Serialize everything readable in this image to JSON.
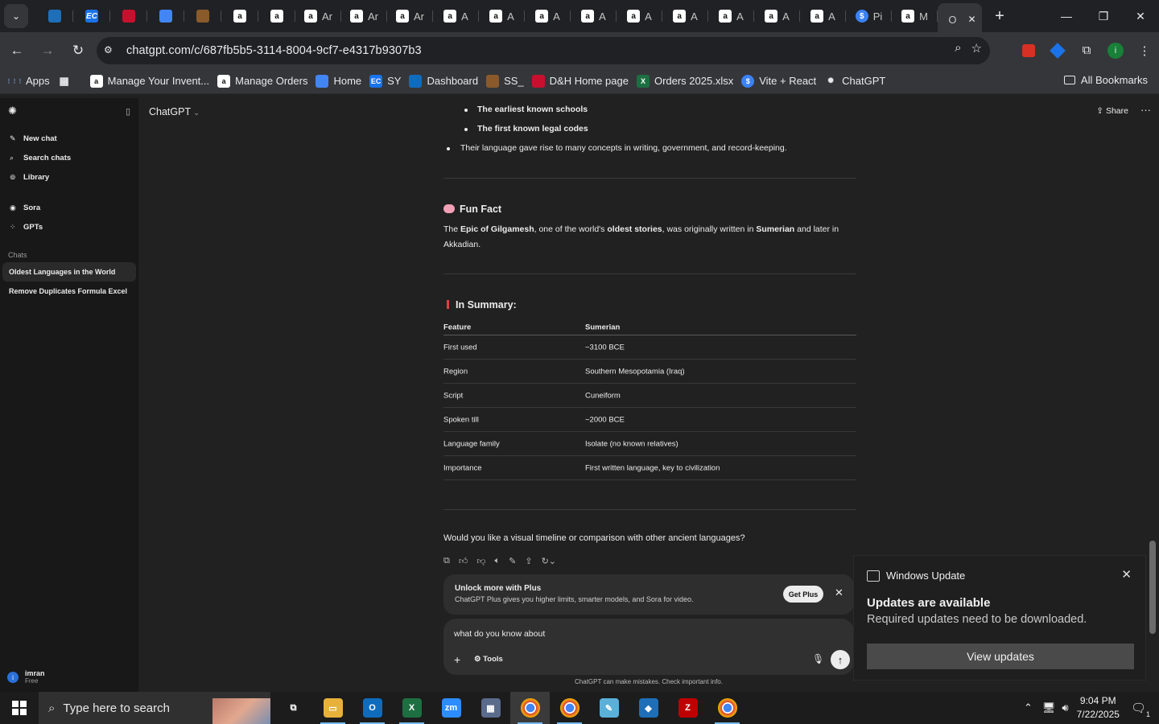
{
  "browser": {
    "tabs": [
      {
        "icon": "app-icon",
        "label": "",
        "bg": "#1e6fb8"
      },
      {
        "icon": "ec-icon",
        "label": "",
        "bg": "#1a73e8"
      },
      {
        "icon": "dh-icon",
        "label": "",
        "bg": "#c8102e"
      },
      {
        "icon": "docs-icon",
        "label": "",
        "bg": "#4285f4"
      },
      {
        "icon": "box-icon",
        "label": "",
        "bg": "#8a5a2b"
      },
      {
        "icon": "amazon-icon",
        "label": "",
        "bg": "#ffffff"
      },
      {
        "icon": "amazon-icon",
        "label": "",
        "bg": "#ffffff"
      },
      {
        "icon": "amazon-icon",
        "label": "Ar",
        "bg": "#ffffff"
      },
      {
        "icon": "amazon-icon",
        "label": "Ar",
        "bg": "#ffffff"
      },
      {
        "icon": "amazon-icon",
        "label": "Ar",
        "bg": "#ffffff"
      },
      {
        "icon": "amazon-icon",
        "label": "A",
        "bg": "#ffffff"
      },
      {
        "icon": "amazon-icon",
        "label": "A",
        "bg": "#ffffff"
      },
      {
        "icon": "amazon-icon",
        "label": "A",
        "bg": "#ffffff"
      },
      {
        "icon": "amazon-icon",
        "label": "A",
        "bg": "#ffffff"
      },
      {
        "icon": "amazon-icon",
        "label": "A",
        "bg": "#ffffff"
      },
      {
        "icon": "amazon-icon",
        "label": "A",
        "bg": "#ffffff"
      },
      {
        "icon": "amazon-icon",
        "label": "A",
        "bg": "#ffffff"
      },
      {
        "icon": "amazon-icon",
        "label": "A",
        "bg": "#ffffff"
      },
      {
        "icon": "amazon-icon",
        "label": "A",
        "bg": "#ffffff"
      },
      {
        "icon": "s-icon",
        "label": "Pi",
        "bg": "#3b82f6"
      },
      {
        "icon": "amazon-icon",
        "label": "M",
        "bg": "#ffffff"
      },
      {
        "icon": "openai-icon",
        "label": "O",
        "bg": "#35363a",
        "active": true
      }
    ],
    "url": "chatgpt.com/c/687fb5b5-3114-8004-9cf7-e4317b9307b3",
    "bookmarks": [
      {
        "icon": "apps-grid-icon",
        "label": "Apps",
        "bg": "#35363a"
      },
      {
        "icon": "grid-icon",
        "label": "",
        "bg": "#35363a"
      },
      {
        "icon": "amazon-icon",
        "label": "Manage Your Invent...",
        "bg": "#ffffff"
      },
      {
        "icon": "amazon-icon",
        "label": "Manage Orders",
        "bg": "#ffffff"
      },
      {
        "icon": "docs-icon",
        "label": "Home",
        "bg": "#4285f4"
      },
      {
        "icon": "ec-icon",
        "label": "SY",
        "bg": "#1a73e8"
      },
      {
        "icon": "dashboard-icon",
        "label": "Dashboard",
        "bg": "#0f6cbd"
      },
      {
        "icon": "box-icon",
        "label": "SS_",
        "bg": "#8a5a2b"
      },
      {
        "icon": "dh-icon",
        "label": "D&H Home page",
        "bg": "#c8102e"
      },
      {
        "icon": "excel-icon",
        "label": "Orders 2025.xlsx",
        "bg": "#1d6f42"
      },
      {
        "icon": "s-icon",
        "label": "Vite + React",
        "bg": "#3b82f6"
      },
      {
        "icon": "openai-icon",
        "label": "ChatGPT",
        "bg": "#35363a"
      }
    ],
    "all_bookmarks": "All Bookmarks"
  },
  "sidebar": {
    "items": [
      {
        "icon": "edit-icon",
        "label": "New chat"
      },
      {
        "icon": "search-icon",
        "label": "Search chats"
      },
      {
        "icon": "library-icon",
        "label": "Library"
      }
    ],
    "items2": [
      {
        "icon": "sora-icon",
        "label": "Sora"
      },
      {
        "icon": "gpts-icon",
        "label": "GPTs"
      }
    ],
    "chats_label": "Chats",
    "chats": [
      {
        "label": "Oldest Languages in the World",
        "selected": true
      },
      {
        "label": "Remove Duplicates Formula Excel",
        "selected": false
      }
    ],
    "user": {
      "initial": "i",
      "name": "imran",
      "plan": "Free"
    }
  },
  "header": {
    "title": "ChatGPT",
    "share": "Share"
  },
  "message": {
    "sub_bullets": [
      "The earliest known schools",
      "The first known legal codes"
    ],
    "bullet": "Their language gave rise to many concepts in writing, government, and record-keeping.",
    "fun_fact_title": "Fun Fact",
    "fun_fact_line1_parts": [
      "The ",
      "Epic of Gilgamesh",
      ", one of the world's ",
      "oldest stories",
      ", was originally written in ",
      "Sumerian",
      " and later in"
    ],
    "fun_fact_line2": "Akkadian.",
    "summary_title": "In Summary:",
    "table": {
      "headers": [
        "Feature",
        "Sumerian"
      ],
      "rows": [
        [
          "First used",
          "~3100 BCE"
        ],
        [
          "Region",
          "Southern Mesopotamia (Iraq)"
        ],
        [
          "Script",
          "Cuneiform"
        ],
        [
          "Spoken till",
          "~2000 BCE"
        ],
        [
          "Language family",
          "Isolate (no known relatives)"
        ],
        [
          "Importance",
          "First written language, key to civilization"
        ]
      ]
    },
    "question": "Would you like a visual timeline or comparison with other ancient languages?"
  },
  "upsell": {
    "title": "Unlock more with Plus",
    "subtitle": "ChatGPT Plus gives you higher limits, smarter models, and Sora for video.",
    "button": "Get Plus"
  },
  "composer": {
    "value": "what do you know about",
    "tools": "Tools"
  },
  "disclaimer": "ChatGPT can make mistakes. Check important info.",
  "notification": {
    "app": "Windows Update",
    "title": "Updates are available",
    "body": "Required updates need to be downloaded.",
    "button": "View updates"
  },
  "taskbar": {
    "search_placeholder": "Type here to search",
    "apps": [
      {
        "icon": "task-view-icon",
        "bg": "transparent",
        "run": false
      },
      {
        "icon": "file-explorer-icon",
        "bg": "#e8b13a",
        "run": true
      },
      {
        "icon": "outlook-icon",
        "bg": "#0f6cbd",
        "run": true
      },
      {
        "icon": "excel-icon",
        "bg": "#1d6f42",
        "run": true
      },
      {
        "icon": "zoom-icon",
        "bg": "#2d8cff",
        "run": false
      },
      {
        "icon": "calculator-icon",
        "bg": "#5a6b8c",
        "run": false
      },
      {
        "icon": "chrome-icon",
        "bg": "#e8a317",
        "run": true,
        "active": true
      },
      {
        "icon": "chrome-icon",
        "bg": "#e8a317",
        "run": true
      },
      {
        "icon": "notepad-icon",
        "bg": "#5bb0d8",
        "run": false
      },
      {
        "icon": "app-icon",
        "bg": "#1e6fb8",
        "run": false
      },
      {
        "icon": "filezilla-icon",
        "bg": "#bf0000",
        "run": false
      },
      {
        "icon": "chrome-icon",
        "bg": "#e8a317",
        "run": true
      }
    ],
    "time": "9:04 PM",
    "date": "7/22/2025",
    "notif_count": "1"
  }
}
